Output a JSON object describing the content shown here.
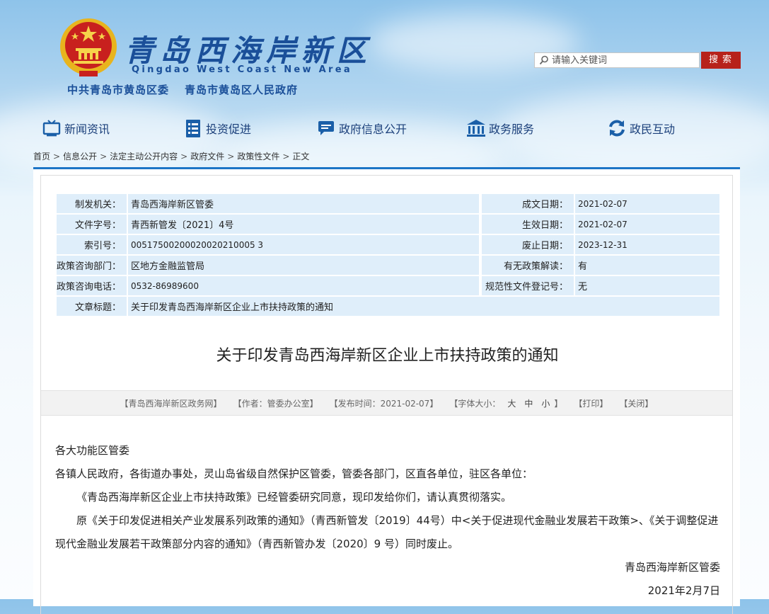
{
  "header": {
    "title": "青岛西海岸新区",
    "title_en": "Qingdao West Coast New Area",
    "sub_left": "中共青岛市黄岛区委",
    "sub_right": "青岛市黄岛区人民政府"
  },
  "search": {
    "placeholder": "请输入关键词",
    "button": "搜索"
  },
  "nav": [
    {
      "label": "新闻资讯",
      "icon": "tv-icon"
    },
    {
      "label": "投资促进",
      "icon": "document-list-icon"
    },
    {
      "label": "政府信息公开",
      "icon": "chat-bubble-icon"
    },
    {
      "label": "政务服务",
      "icon": "building-icon"
    },
    {
      "label": "政民互动",
      "icon": "refresh-cycle-icon"
    }
  ],
  "breadcrumb": [
    "首页",
    "信息公开",
    "法定主动公开内容",
    "政府文件",
    "政策性文件",
    "正文"
  ],
  "meta": {
    "issuer_k": "制发机关：",
    "issuer_v": "青岛西海岸新区管委",
    "written_k": "成文日期：",
    "written_v": "2021-02-07",
    "docno_k": "文件字号：",
    "docno_v": "青西新管发〔2021〕4号",
    "effective_k": "生效日期：",
    "effective_v": "2021-02-07",
    "index_k": "索引号：",
    "index_v": "00517500200020020210005 3",
    "repeal_k": "废止日期：",
    "repeal_v": "2023-12-31",
    "dept_k": "政策咨询部门：",
    "dept_v": "区地方金融监管局",
    "interp_k": "有无政策解读：",
    "interp_v": "有",
    "phone_k": "政策咨询电话：",
    "phone_v": "0532-86989600",
    "reg_k": "规范性文件登记号：",
    "reg_v": "无",
    "subject_k": "文章标题：",
    "subject_v": "关于印发青岛西海岸新区企业上市扶持政策的通知"
  },
  "doc_title": "关于印发青岛西海岸新区企业上市扶持政策的通知",
  "info_bar": {
    "source": "【青岛西海岸新区政务网】",
    "author": "【作者：管委办公室】",
    "date": "【发布时间：2021-02-07】",
    "font_label": "【字体大小：",
    "font_large": "大",
    "font_medium": "中",
    "font_small": "小",
    "font_end": "】",
    "print": "【打印】",
    "close": "【关闭】"
  },
  "body": {
    "p1": "各大功能区管委",
    "p2": "各镇人民政府，各街道办事处，灵山岛省级自然保护区管委，管委各部门，区直各单位，驻区各单位：",
    "p3": "《青岛西海岸新区企业上市扶持政策》已经管委研究同意，现印发给你们，请认真贯彻落实。",
    "p4": "原《关于印发促进相关产业发展系列政策的通知》（青西新管发〔2019〕44号）中<关于促进现代金融业发展若干政策>、《关于调整促进现代金融业发展若干政策部分内容的通知》（青西新管办发〔2020〕9 号）同时废止。",
    "signature": "青岛西海岸新区管委",
    "date": "2021年2月7日"
  }
}
